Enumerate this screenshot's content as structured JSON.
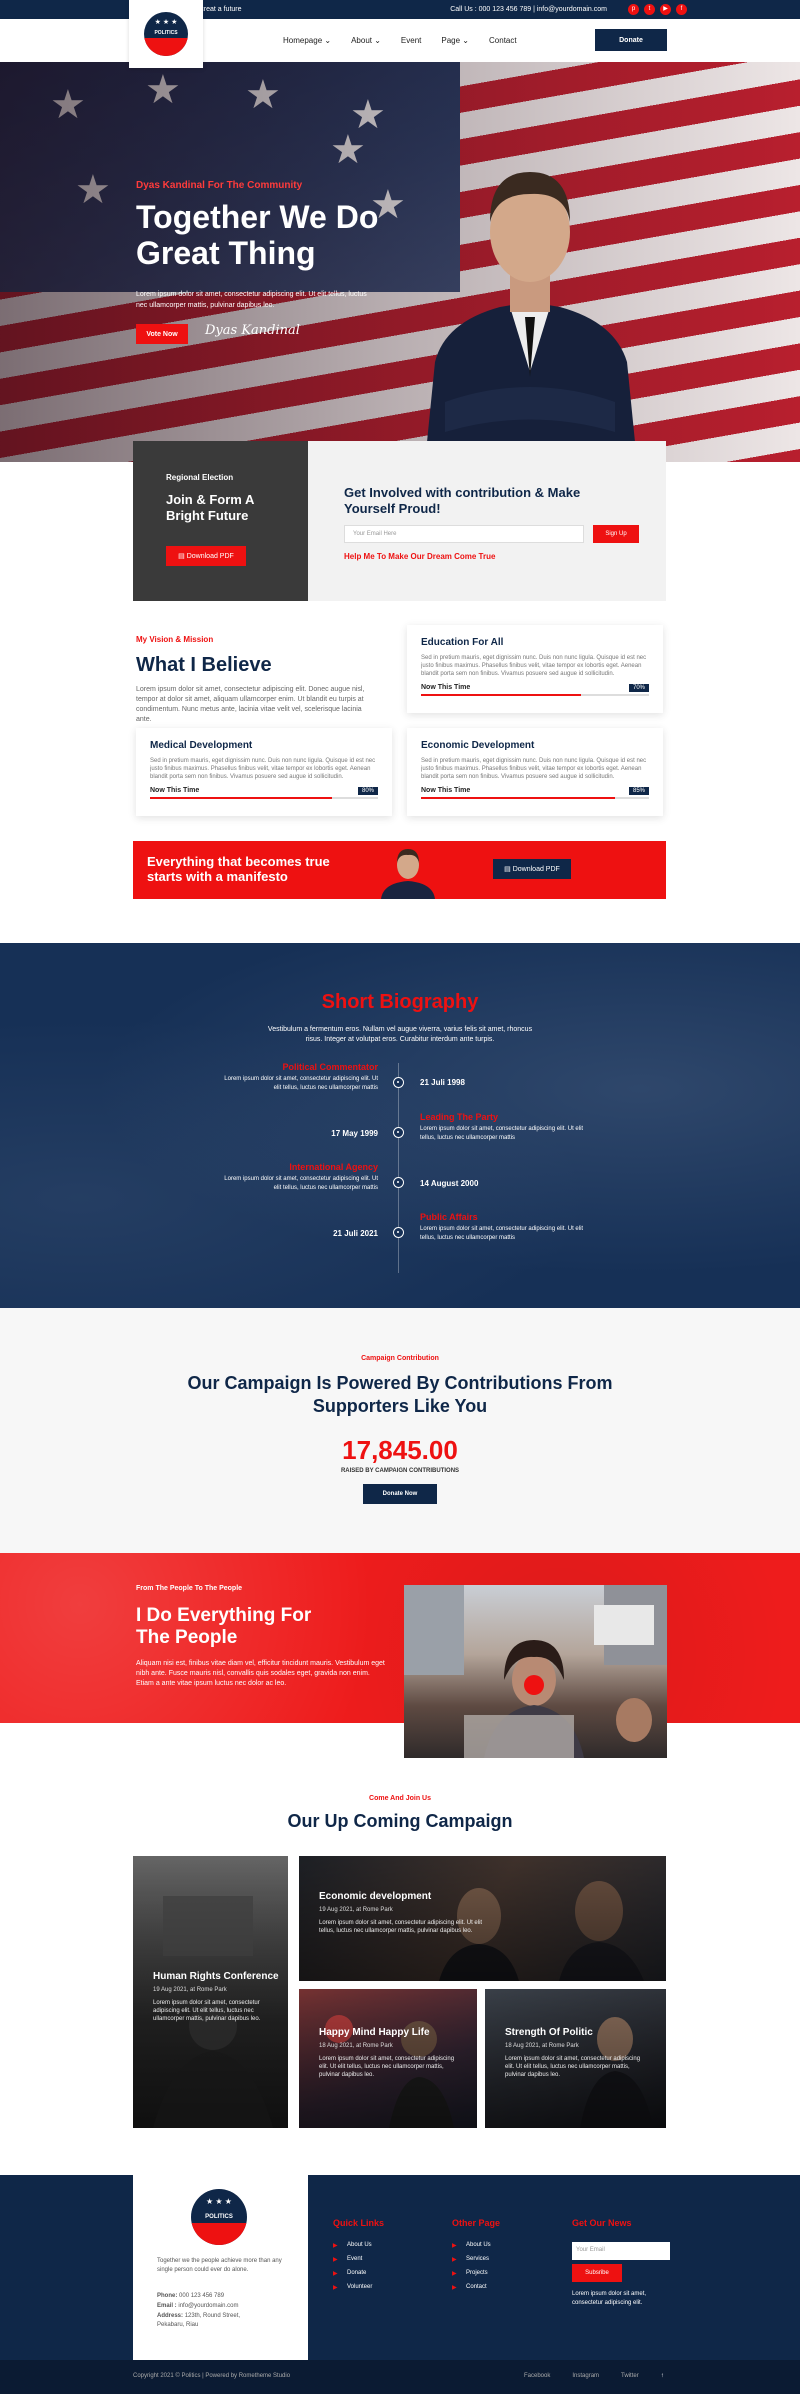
{
  "topbar": {
    "slogan": "Your vote creat a future",
    "contact": "Call Us : 000 123 456 789 | info@yourdomain.com"
  },
  "logo": {
    "text": "POLITICS"
  },
  "nav": {
    "items": [
      "Homepage",
      "About",
      "Event",
      "Page",
      "Contact"
    ],
    "donate": "Donate"
  },
  "hero": {
    "sub": "Dyas Kandinal For The Community",
    "title": "Together We Do Great Thing",
    "desc": "Lorem ipsum dolor sit amet, consectetur adipiscing elit. Ut elit tellus, luctus nec ullamcorper mattis, pulvinar dapibus leo.",
    "btn": "Vote Now",
    "signature": "Dyas Kandinal"
  },
  "election": {
    "label": "Regional Election",
    "title": "Join & Form A Bright Future",
    "btn": "Download PDF"
  },
  "involve": {
    "title": "Get Involved with contribution & Make Yourself Proud!",
    "placeholder": "Your Email Here",
    "btn": "Sign Up",
    "help": "Help Me To Make Our Dream Come True"
  },
  "vision": {
    "label": "My Vision & Mission",
    "title": "What I Believe",
    "desc": "Lorem ipsum dolor sit amet, consectetur adipiscing elit. Donec augue nisl, tempor at dolor sit amet, aliquam ullamcorper enim. Ut blandit eu turpis at condimentum. Nunc metus ante, lacinia vitae velit vel, scelerisque lacinia ante."
  },
  "cards": [
    {
      "title": "Education For All",
      "desc": "Sed in pretium mauris, eget dignissim nunc. Duis non nunc ligula. Quisque id est nec justo finibus maximus. Phasellus finibus velit, vitae tempor ex lobortis eget. Aenean blandit porta sem non finibus. Vivamus posuere sed augue id sollicitudin.",
      "now": "Now This Time",
      "pct": "70%",
      "fill": 0.7
    },
    {
      "title": "Medical Development",
      "desc": "Sed in pretium mauris, eget dignissim nunc. Duis non nunc ligula. Quisque id est nec justo finibus maximus. Phasellus finibus velit, vitae tempor ex lobortis eget. Aenean blandit porta sem non finibus. Vivamus posuere sed augue id sollicitudin.",
      "now": "Now This Time",
      "pct": "80%",
      "fill": 0.8
    },
    {
      "title": "Economic Development",
      "desc": "Sed in pretium mauris, eget dignissim nunc. Duis non nunc ligula. Quisque id est nec justo finibus maximus. Phasellus finibus velit, vitae tempor ex lobortis eget. Aenean blandit porta sem non finibus. Vivamus posuere sed augue id sollicitudin.",
      "now": "Now This Time",
      "pct": "85%",
      "fill": 0.85
    }
  ],
  "manifesto": {
    "text": "Everything that becomes true starts with a manifesto",
    "btn": "Download PDF"
  },
  "bio": {
    "title": "Short Biography",
    "intro": "Vestibulum a fermentum eros. Nullam vel augue viverra, varius felis sit amet, rhoncus risus. Integer at volutpat eros. Curabitur interdum ante turpis.",
    "entries": [
      {
        "title": "Political Commentator",
        "desc": "Lorem ipsum dolor sit amet, consectetur adipiscing elit. Ut elit tellus, luctus nec ullamcorper mattis",
        "date": "21 Juli 1998"
      },
      {
        "title": "Leading The Party",
        "desc": "Lorem ipsum dolor sit amet, consectetur adipiscing elit. Ut elit tellus, luctus nec ullamcorper mattis",
        "date": "17 May 1999"
      },
      {
        "title": "International Agency",
        "desc": "Lorem ipsum dolor sit amet, consectetur adipiscing elit. Ut elit tellus, luctus nec ullamcorper mattis",
        "date": "14 August 2000"
      },
      {
        "title": "Public Affairs",
        "desc": "Lorem ipsum dolor sit amet, consectetur adipiscing elit. Ut elit tellus, luctus nec ullamcorper mattis",
        "date": "21 Juli 2021"
      }
    ]
  },
  "contrib": {
    "label": "Campaign Contribution",
    "title": "Our Campaign Is Powered By Contributions From Supporters Like You",
    "amount": "17,845.00",
    "raised": "RAISED BY CAMPAIGN CONTRIBUTIONS",
    "btn": "Donate Now"
  },
  "people": {
    "label": "From The People To The People",
    "title": "I Do Everything For The People",
    "desc": "Aliquam nisi est, finibus vitae diam vel, efficitur tincidunt mauris. Vestibulum eget nibh ante. Fusce mauris nisl, convallis quis sodales eget, gravida non enim. Etiam a ante vitae ipsum luctus nec dolor ac leo."
  },
  "upcoming": {
    "label": "Come And Join Us",
    "title": "Our Up Coming Campaign",
    "events": [
      {
        "title": "Human Rights Conference",
        "date": "19 Aug 2021, at Rome Park",
        "desc": "Lorem ipsum dolor sit amet, consectetur adipiscing elit. Ut elit tellus, luctus nec ullamcorper mattis, pulvinar dapibus leo."
      },
      {
        "title": "Economic development",
        "date": "19 Aug 2021, at Rome Park",
        "desc": "Lorem ipsum dolor sit amet, consectetur adipiscing elit. Ut elit tellus, luctus nec ullamcorper mattis, pulvinar dapibus leo."
      },
      {
        "title": "Happy Mind Happy Life",
        "date": "18 Aug 2021, at Rome Park",
        "desc": "Lorem ipsum dolor sit amet, consectetur adipiscing elit. Ut elit tellus, luctus nec ullamcorper mattis, pulvinar dapibus leo."
      },
      {
        "title": "Strength Of Politic",
        "date": "18 Aug 2021, at Rome Park",
        "desc": "Lorem ipsum dolor sit amet, consectetur adipiscing elit. Ut elit tellus, luctus nec ullamcorper mattis, pulvinar dapibus leo."
      }
    ]
  },
  "footer": {
    "about": "Together we the people achieve more than any single person could ever do alone.",
    "phone_label": "Phone:",
    "phone": "000 123 456 789",
    "email_label": "Email :",
    "email": "info@yourdomain.com",
    "address_label": "Address:",
    "address": "123th, Round Street, Pekabaru, Riau",
    "quick_title": "Quick Links",
    "quick": [
      "About Us",
      "Event",
      "Donate",
      "Volunteer"
    ],
    "other_title": "Other Page",
    "other": [
      "About Us",
      "Services",
      "Projects",
      "Contact"
    ],
    "news_title": "Get Our News",
    "news_placeholder": "Your Email",
    "subscribe": "Subsribe",
    "news_desc": "Lorem ipsum dolor sit amet, consectetur adipiscing elit.",
    "copyright": "Copyright 2021 © Politics | Powered by Rometheme Studio",
    "links": [
      "Facebook",
      "Instagram",
      "Twitter"
    ]
  }
}
